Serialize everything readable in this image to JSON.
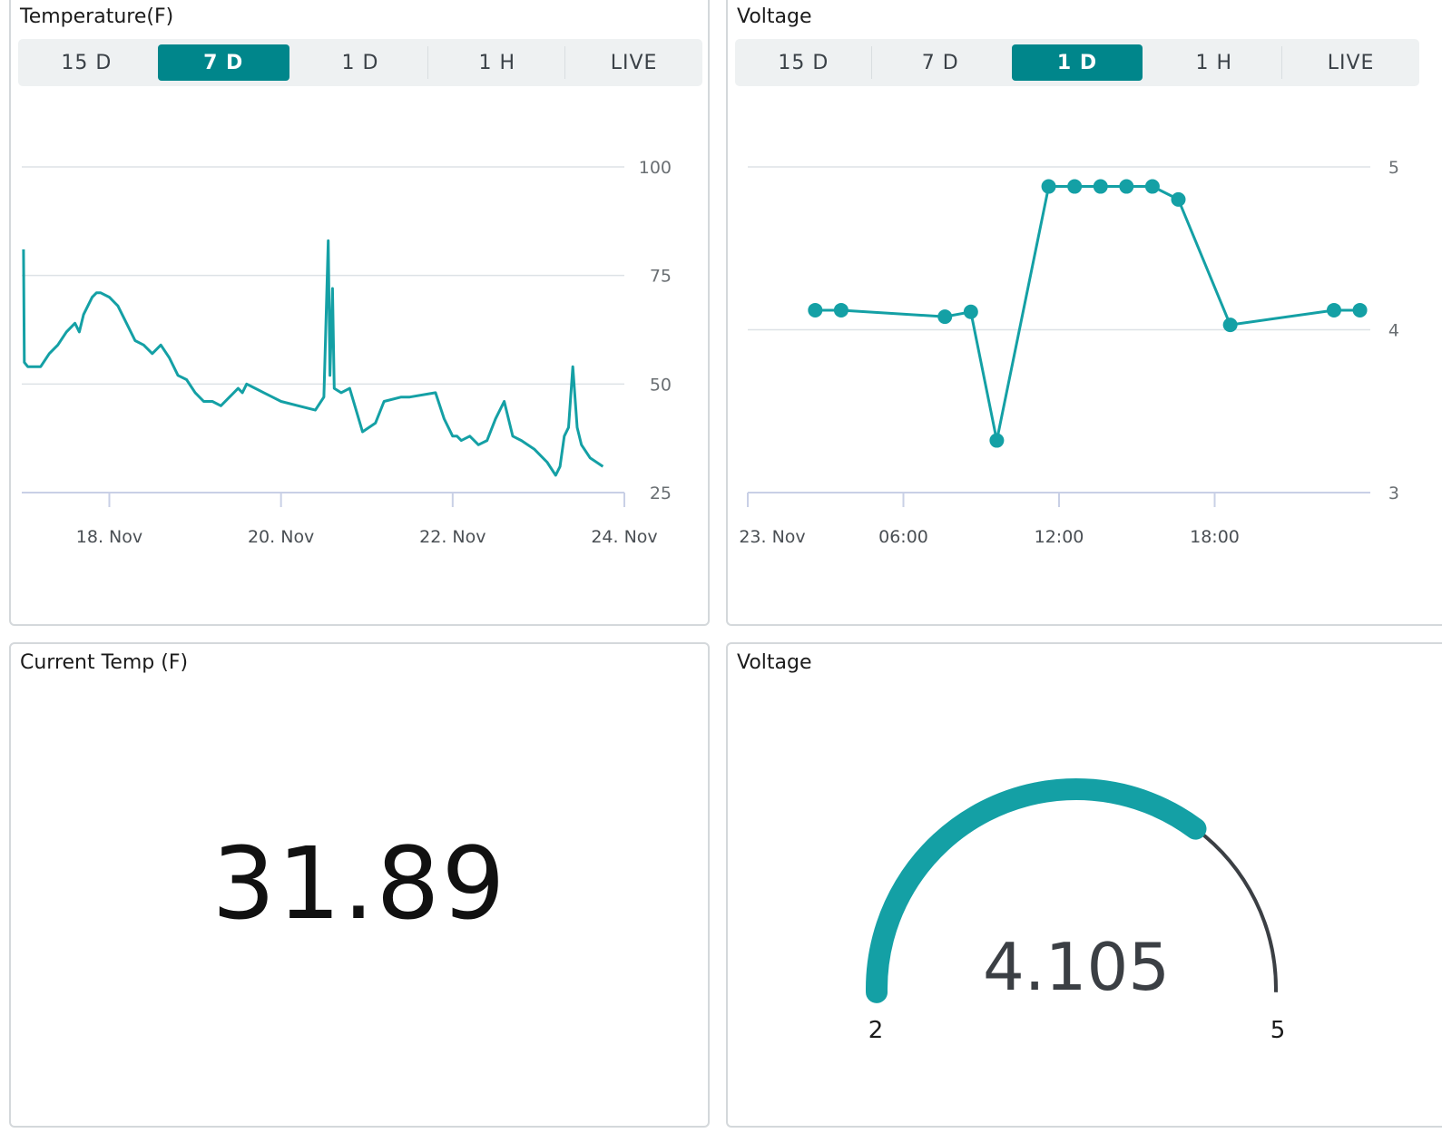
{
  "colors": {
    "accent": "#00868b",
    "line": "#14a0a5",
    "grid": "#dde2e6",
    "gauge_track": "#3b3f44"
  },
  "temp_chart": {
    "title": "Temperature(F)",
    "ranges": [
      "15 D",
      "7 D",
      "1 D",
      "1 H",
      "LIVE"
    ],
    "active_range": "7 D"
  },
  "volt_chart": {
    "title": "Voltage",
    "ranges": [
      "15 D",
      "7 D",
      "1 D",
      "1 H",
      "LIVE"
    ],
    "active_range": "1 D"
  },
  "temp_value": {
    "title": "Current Temp (F)",
    "value": "31.89"
  },
  "volt_gauge": {
    "title": "Voltage",
    "value": "4.105",
    "min_label": "2",
    "max_label": "5",
    "min": 2,
    "max": 5,
    "level": 4.105
  },
  "chart_data": [
    {
      "type": "line",
      "title": "Temperature(F)",
      "xlabel": "",
      "ylabel": "",
      "x_ticks": [
        "18. Nov",
        "20. Nov",
        "22. Nov",
        "24. Nov"
      ],
      "y_ticks": [
        25,
        50,
        75,
        100
      ],
      "ylim": [
        25,
        100
      ],
      "xlim": [
        16.98,
        24.0
      ],
      "x_unit": "Nov day",
      "grid": true,
      "series": [
        {
          "x": [
            17.0,
            17.01,
            17.05,
            17.1,
            17.2,
            17.3,
            17.4,
            17.5,
            17.6,
            17.65,
            17.7,
            17.8,
            17.85,
            17.9,
            18.0,
            18.1,
            18.2,
            18.3,
            18.4,
            18.5,
            18.6,
            18.7,
            18.8,
            18.9,
            19.0,
            19.1,
            19.2,
            19.3,
            19.4,
            19.5,
            19.55,
            19.6,
            19.7,
            19.8,
            19.9,
            20.0,
            20.2,
            20.4,
            20.5,
            20.55,
            20.57,
            20.6,
            20.62,
            20.7,
            20.8,
            20.95,
            21.1,
            21.2,
            21.4,
            21.5,
            21.8,
            21.9,
            22.0,
            22.05,
            22.1,
            22.2,
            22.3,
            22.4,
            22.5,
            22.6,
            22.7,
            22.8,
            22.95,
            23.1,
            23.2,
            23.25,
            23.3,
            23.35,
            23.4,
            23.45,
            23.5,
            23.6,
            23.75
          ],
          "y": [
            81,
            55,
            54,
            54,
            54,
            57,
            59,
            62,
            64,
            62,
            66,
            70,
            71,
            71,
            70,
            68,
            64,
            60,
            59,
            57,
            59,
            56,
            52,
            51,
            48,
            46,
            46,
            45,
            47,
            49,
            48,
            50,
            49,
            48,
            47,
            46,
            45,
            44,
            47,
            83,
            52,
            72,
            49,
            48,
            49,
            39,
            41,
            46,
            47,
            47,
            48,
            42,
            38,
            38,
            37,
            38,
            36,
            37,
            42,
            46,
            38,
            37,
            35,
            32,
            29,
            31,
            38,
            40,
            54,
            40,
            36,
            33,
            31
          ]
        }
      ]
    },
    {
      "type": "line",
      "title": "Voltage",
      "xlabel": "",
      "ylabel": "",
      "x_ticks": [
        "23. Nov",
        "06:00",
        "12:00",
        "18:00"
      ],
      "y_ticks": [
        3,
        4,
        5
      ],
      "ylim": [
        3,
        5
      ],
      "xlim": [
        0,
        24
      ],
      "x_unit": "hours from 23. Nov 00:00",
      "grid": true,
      "markers": true,
      "series": [
        {
          "x": [
            2.6,
            3.6,
            7.6,
            8.6,
            9.6,
            11.6,
            12.6,
            13.6,
            14.6,
            15.6,
            16.6,
            18.6,
            22.6,
            23.6
          ],
          "y": [
            4.12,
            4.12,
            4.08,
            4.11,
            3.32,
            4.88,
            4.88,
            4.88,
            4.88,
            4.88,
            4.8,
            4.03,
            4.12,
            4.12
          ]
        }
      ]
    }
  ]
}
